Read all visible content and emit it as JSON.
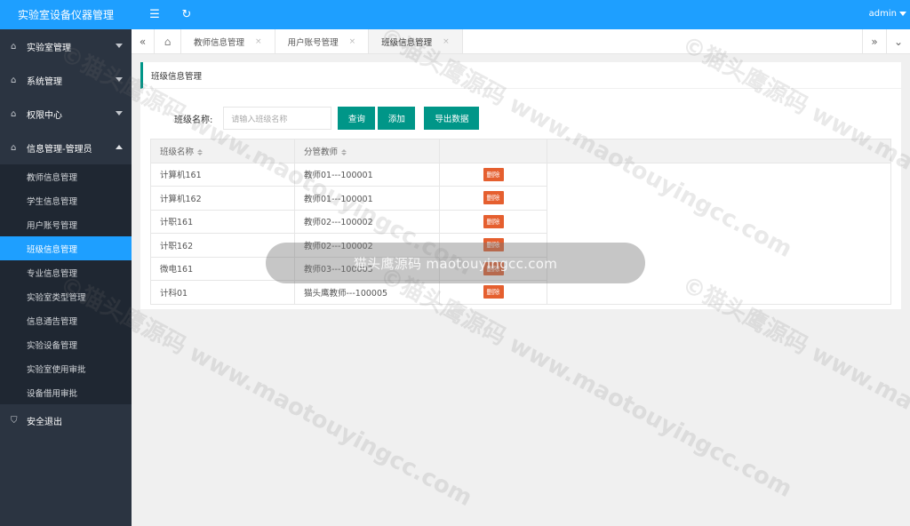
{
  "app": {
    "title": "实验室设备仪器管理"
  },
  "sidebar": {
    "groups": [
      {
        "label": "实验室管理",
        "icon": "home-icon"
      },
      {
        "label": "系统管理",
        "icon": "home-icon"
      },
      {
        "label": "权限中心",
        "icon": "home-icon"
      },
      {
        "label": "信息管理-管理员",
        "icon": "home-icon"
      }
    ],
    "submenu": [
      "教师信息管理",
      "学生信息管理",
      "用户账号管理",
      "班级信息管理",
      "专业信息管理",
      "实验室类型管理",
      "信息通告管理",
      "实验设备管理",
      "实验室使用审批",
      "设备借用审批"
    ],
    "active_index": 3,
    "logout": "安全退出"
  },
  "header": {
    "user": "admin"
  },
  "tabs": [
    {
      "label": "教师信息管理",
      "active": false
    },
    {
      "label": "用户账号管理",
      "active": false
    },
    {
      "label": "班级信息管理",
      "active": true
    }
  ],
  "panel": {
    "title": "班级信息管理",
    "search_label": "班级名称:",
    "search_placeholder": "请输入班级名称",
    "query_btn": "查询",
    "add_btn": "添加",
    "export_btn": "导出数据"
  },
  "table": {
    "headers": [
      "班级名称",
      "分管教师"
    ],
    "rows": [
      {
        "name": "计算机161",
        "teacher": "教师01---100001",
        "action": "删除"
      },
      {
        "name": "计算机162",
        "teacher": "教师01---100001",
        "action": "删除"
      },
      {
        "name": "计职161",
        "teacher": "教师02---100002",
        "action": "删除"
      },
      {
        "name": "计职162",
        "teacher": "教师02---100002",
        "action": "删除"
      },
      {
        "name": "微电161",
        "teacher": "教师03---100003",
        "action": "删除"
      },
      {
        "name": "计科01",
        "teacher": "猫头鹰教师---100005",
        "action": "删除"
      }
    ]
  },
  "toast": "猫头鹰源码 maotouyingcc.com",
  "watermark": "©猫头鹰源码 www.maotouyingcc.com",
  "colors": {
    "primary": "#1e9fff",
    "sidebar": "#2b3441",
    "button": "#009688",
    "delete": "#e55f2f"
  }
}
